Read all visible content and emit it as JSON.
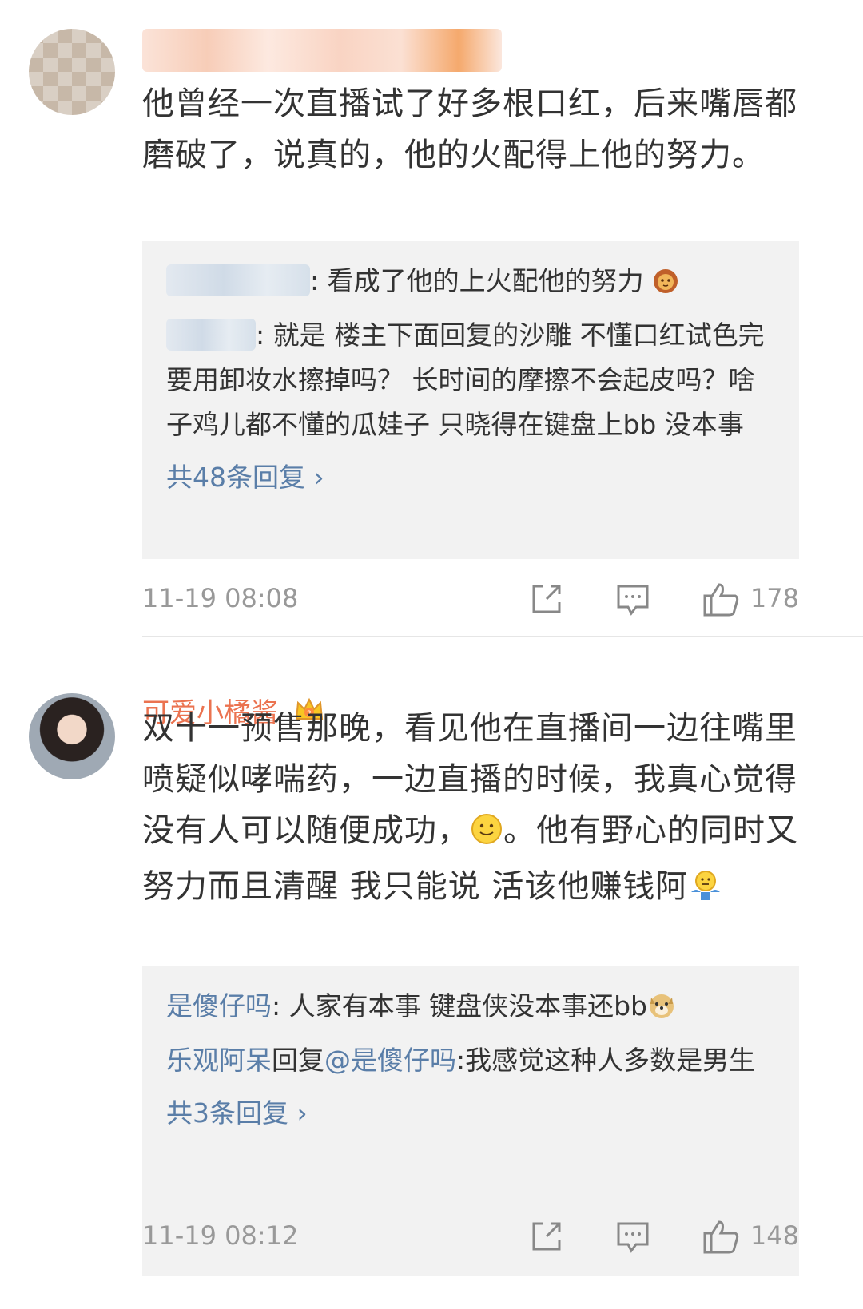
{
  "comments": [
    {
      "username": "",
      "text": "他曾经一次直播试了好多根口红，后来嘴唇都磨破了，说真的，他的火配得上他的努力。",
      "replies": [
        {
          "name": "",
          "text": ": 看成了他的上火配他的努力"
        },
        {
          "name": "",
          "text": ": 就是 楼主下面回复的沙雕 不懂口红试色完 要用卸妆水擦掉吗？ 长时间的摩擦不会起皮吗？啥子鸡儿都不懂的瓜娃子 只晓得在键盘上bb 没本事"
        }
      ],
      "more_replies": "共48条回复 ›",
      "time": "11-19 08:08",
      "likes": "178"
    },
    {
      "username": "可爱小橘酱",
      "text_part1": "双十一预售那晚，看见他在直播间一边往嘴里喷疑似哮喘药，一边直播的时候，我真心觉得没有人可以随便成功，",
      "text_part2": "。他有野心的同时又努力而且清醒 我只能说 活该他赚钱阿",
      "replies": [
        {
          "name": "是傻仔吗",
          "text": ": 人家有本事  键盘侠没本事还bb"
        },
        {
          "name": "乐观阿呆",
          "mid": "回复",
          "mention": "@是傻仔吗",
          "text": ":我感觉这种人多数是男生"
        }
      ],
      "more_replies": "共3条回复 ›",
      "time": "11-19 08:12",
      "likes": "148"
    }
  ]
}
